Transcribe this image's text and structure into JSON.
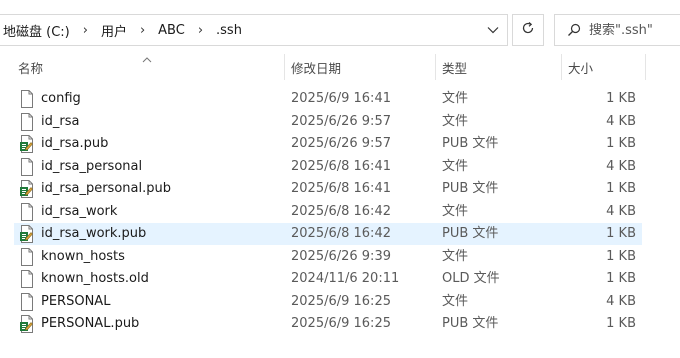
{
  "address": {
    "crumbs": [
      "地磁盘 (C:)",
      "用户",
      "ABC",
      ".ssh"
    ],
    "separator": "›"
  },
  "search": {
    "placeholder": "搜索\".ssh\""
  },
  "columns": {
    "name": "名称",
    "date": "修改日期",
    "type": "类型",
    "size": "大小"
  },
  "files": [
    {
      "name": "config",
      "date": "2025/6/9 16:41",
      "type": "文件",
      "size": "1 KB",
      "icon": "blank-file-icon"
    },
    {
      "name": "id_rsa",
      "date": "2025/6/26 9:57",
      "type": "文件",
      "size": "4 KB",
      "icon": "blank-file-icon"
    },
    {
      "name": "id_rsa.pub",
      "date": "2025/6/26 9:57",
      "type": "PUB 文件",
      "size": "1 KB",
      "icon": "publisher-file-icon"
    },
    {
      "name": "id_rsa_personal",
      "date": "2025/6/8 16:41",
      "type": "文件",
      "size": "4 KB",
      "icon": "blank-file-icon"
    },
    {
      "name": "id_rsa_personal.pub",
      "date": "2025/6/8 16:41",
      "type": "PUB 文件",
      "size": "1 KB",
      "icon": "publisher-file-icon"
    },
    {
      "name": "id_rsa_work",
      "date": "2025/6/8 16:42",
      "type": "文件",
      "size": "4 KB",
      "icon": "blank-file-icon"
    },
    {
      "name": "id_rsa_work.pub",
      "date": "2025/6/8 16:42",
      "type": "PUB 文件",
      "size": "1 KB",
      "icon": "publisher-file-icon",
      "selected": true
    },
    {
      "name": "known_hosts",
      "date": "2025/6/26 9:39",
      "type": "文件",
      "size": "1 KB",
      "icon": "blank-file-icon"
    },
    {
      "name": "known_hosts.old",
      "date": "2024/11/6 20:11",
      "type": "OLD 文件",
      "size": "1 KB",
      "icon": "blank-file-icon"
    },
    {
      "name": "PERSONAL",
      "date": "2025/6/9 16:25",
      "type": "文件",
      "size": "4 KB",
      "icon": "blank-file-icon"
    },
    {
      "name": "PERSONAL.pub",
      "date": "2025/6/9 16:25",
      "type": "PUB 文件",
      "size": "1 KB",
      "icon": "publisher-file-icon"
    }
  ],
  "colors": {
    "selection": "#e5f3ff",
    "border": "#d9d9d9"
  }
}
